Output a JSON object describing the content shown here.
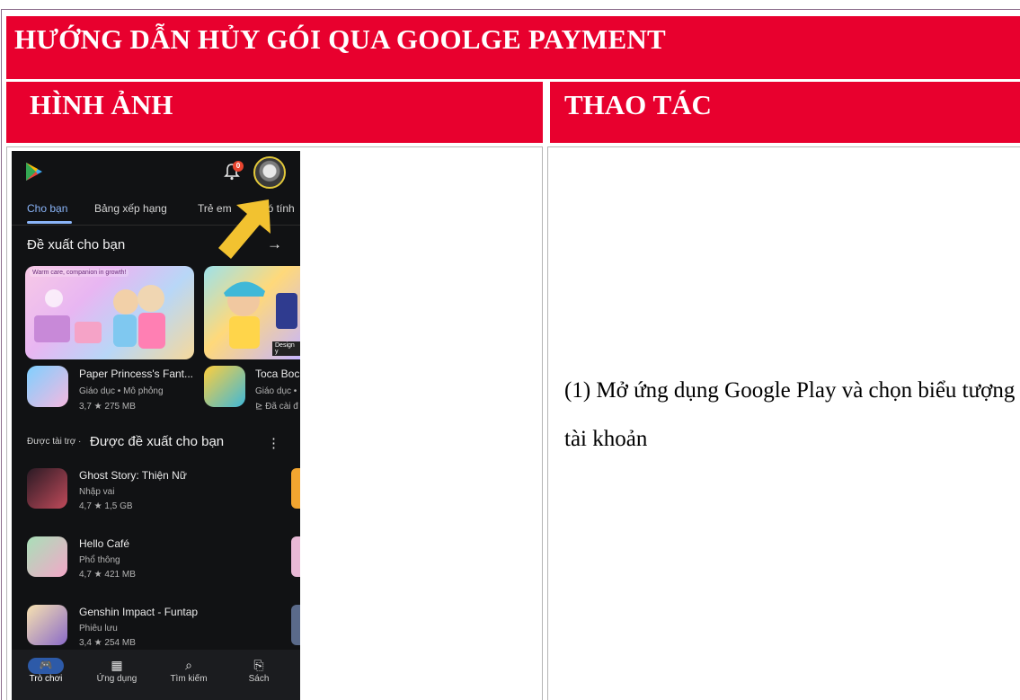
{
  "title": "HƯỚNG DẪN HỦY GÓI QUA GOOLGE PAYMENT",
  "table": {
    "col_image_header": "HÌNH ẢNH",
    "col_action_header": "THAO TÁC",
    "step_1_text": "(1) Mở ứng dụng Google Play và chọn biểu tượng tài khoản"
  },
  "colors": {
    "header_red": "#e8002e",
    "phone_bg": "#111214",
    "accent_blue": "#8ab4f8",
    "arrow_yellow": "#f2c230"
  },
  "phone": {
    "notification_count": "0",
    "tabs": [
      {
        "label": "Cho bạn",
        "active": true
      },
      {
        "label": "Bảng xếp hạng",
        "active": false
      },
      {
        "label": "Trẻ em",
        "active": false
      },
      {
        "label": "Có tính",
        "active": false
      }
    ],
    "section_title": "Đề xuất cho bạn",
    "section_arrow": "→",
    "banner1_tag": "Warm care, companion in growth!",
    "banner2_tag": "Design y",
    "featured_apps": [
      {
        "name": "Paper Princess's Fant...",
        "category": "Giáo dục • Mô phỏng",
        "meta": "3,7 ★  275 MB"
      },
      {
        "name": "Toca Boc",
        "category": "Giáo dục •",
        "meta": "⊵ Đã cài đ"
      }
    ],
    "sponsored_label": "Được tài trợ ·",
    "sponsored_title": "Được đề xuất cho bạn",
    "sponsored_menu": "⋮",
    "list_apps": [
      {
        "name": "Ghost Story: Thiện Nữ",
        "genre": "Nhập vai",
        "meta": "4,7 ★  1,5 GB"
      },
      {
        "name": "Hello Café",
        "genre": "Phổ thông",
        "meta": "4,7 ★  421 MB"
      },
      {
        "name": "Genshin Impact - Funtap",
        "genre": "Phiêu lưu",
        "meta": "3,4 ★  254 MB"
      }
    ],
    "bottom_nav": [
      {
        "label": "Trò chơi",
        "icon": "gamepad-icon",
        "glyph": "🎮",
        "active": true
      },
      {
        "label": "Ứng dụng",
        "icon": "apps-grid-icon",
        "glyph": "▦",
        "active": false
      },
      {
        "label": "Tìm kiếm",
        "icon": "search-icon",
        "glyph": "⌕",
        "active": false
      },
      {
        "label": "Sách",
        "icon": "bookmark-icon",
        "glyph": "⎘",
        "active": false
      }
    ]
  }
}
